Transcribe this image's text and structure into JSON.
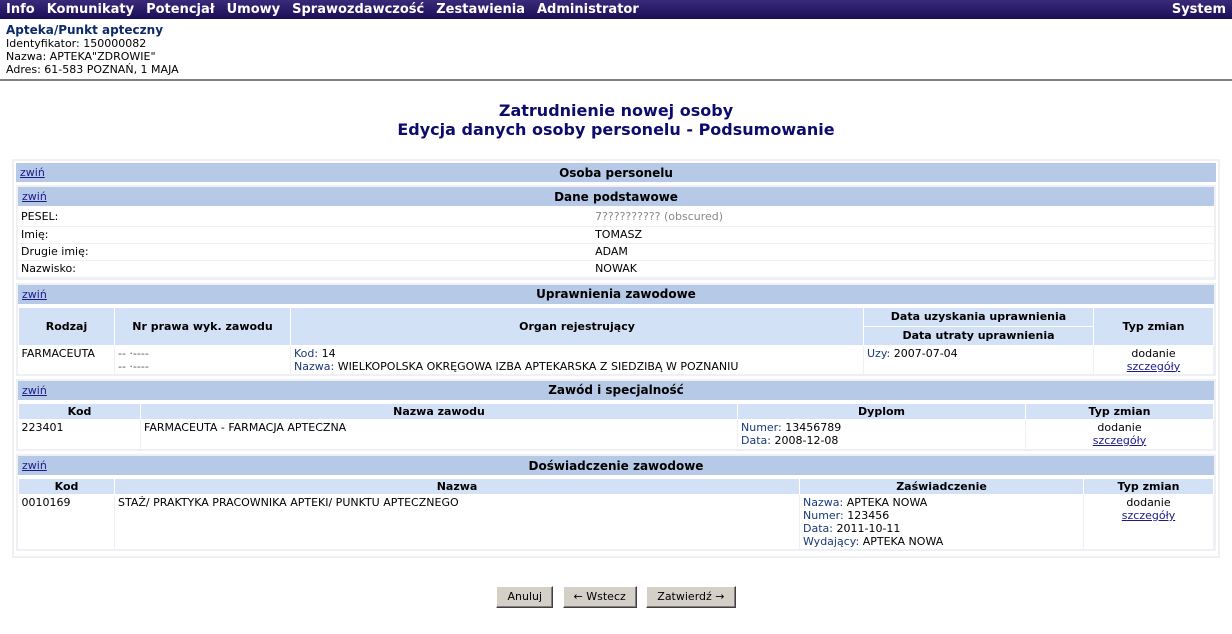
{
  "menu": {
    "items": [
      "Info",
      "Komunikaty",
      "Potencjał",
      "Umowy",
      "Sprawozdawczość",
      "Zestawienia",
      "Administrator"
    ],
    "right": "System"
  },
  "pharmacy": {
    "title": "Apteka/Punkt apteczny",
    "id_line": "Identyfikator: 150000082",
    "name_line": "Nazwa: APTEKA\"ZDROWIE\"",
    "address_line": "Adres: 61-583 POZNAŃ, 1 MAJA"
  },
  "page": {
    "title_line1": "Zatrudnienie nowej osoby",
    "title_line2": "Edycja danych osoby personelu - Podsumowanie"
  },
  "collapse_label": "zwiń",
  "details_label": "szczegóły",
  "person": {
    "header": "Osoba personelu",
    "basic": {
      "header": "Dane podstawowe",
      "rows": [
        {
          "label": "PESEL:",
          "value": "7?????????? (obscured)"
        },
        {
          "label": "Imię:",
          "value": "TOMASZ"
        },
        {
          "label": "Drugie imię:",
          "value": "ADAM"
        },
        {
          "label": "Nazwisko:",
          "value": "NOWAK"
        }
      ]
    },
    "permissions": {
      "header": "Uprawnienia zawodowe",
      "columns": [
        "Rodzaj",
        "Nr prawa wyk. zawodu",
        "Organ rejestrujący",
        "Data uzyskania uprawnienia",
        "Data utraty uprawnienia",
        "Typ zmian"
      ],
      "rows": [
        {
          "rodzaj": "FARMACEUTA",
          "nr_line1": "-- ·----",
          "nr_line2": "-- ·----",
          "kod_label": "Kod:",
          "kod": "14",
          "nazwa_label": "Nazwa:",
          "nazwa": "WIELKOPOLSKA OKRĘGOWA IZBA APTEKARSKA Z SIEDZIBĄ W POZNANIU",
          "uzy_label": "Uzy:",
          "uzy": "2007-07-04",
          "typ": "dodanie"
        }
      ]
    },
    "profession": {
      "header": "Zawód i specjalność",
      "columns": [
        "Kod",
        "Nazwa zawodu",
        "Dyplom",
        "Typ zmian"
      ],
      "rows": [
        {
          "kod": "223401",
          "nazwa": "FARMACEUTA - FARMACJA APTECZNA",
          "numer_label": "Numer:",
          "numer": "13456789",
          "data_label": "Data:",
          "data": "2008-12-08",
          "typ": "dodanie"
        }
      ]
    },
    "experience": {
      "header": "Doświadczenie zawodowe",
      "columns": [
        "Kod",
        "Nazwa",
        "Zaświadczenie",
        "Typ zmian"
      ],
      "rows": [
        {
          "kod": "0010169",
          "nazwa": "STAŻ/ PRAKTYKA PRACOWNIKA APTEKI/ PUNKTU APTECZNEGO",
          "z_nazwa_label": "Nazwa:",
          "z_nazwa": "APTEKA NOWA",
          "z_numer_label": "Numer:",
          "z_numer": "123456",
          "z_data_label": "Data:",
          "z_data": "2011-10-11",
          "z_wyd_label": "Wydający:",
          "z_wyd": "APTEKA NOWA",
          "typ": "dodanie"
        }
      ]
    }
  },
  "buttons": {
    "cancel": "Anuluj",
    "back": "← Wstecz",
    "confirm": "Zatwierdź →"
  }
}
